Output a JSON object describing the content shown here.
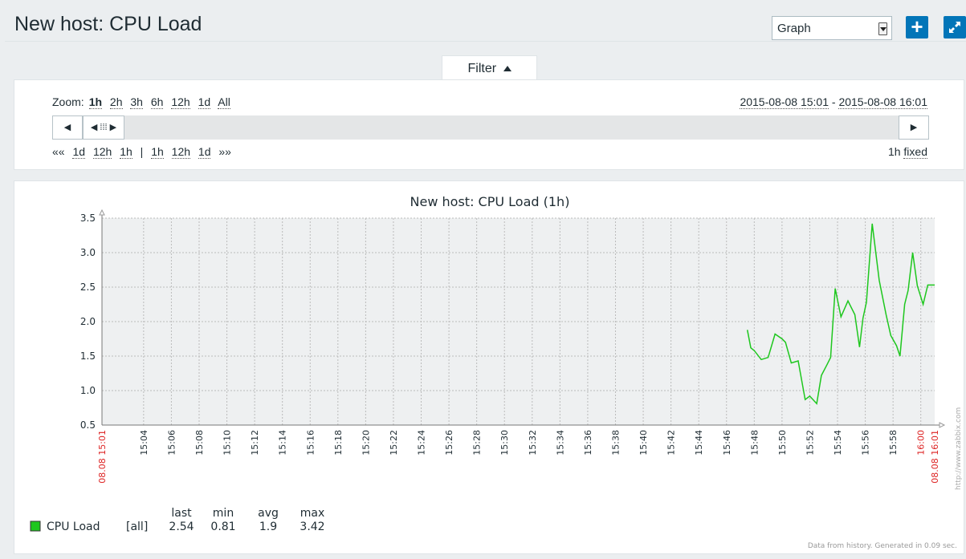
{
  "header": {
    "title": "New host: CPU Load",
    "view_select": "Graph"
  },
  "filter": {
    "tab_label": "Filter",
    "zoom_label": "Zoom:",
    "zoom_options": [
      "1h",
      "2h",
      "3h",
      "6h",
      "12h",
      "1d",
      "All"
    ],
    "period_from": "2015-08-08 15:01",
    "period_separator": "-",
    "period_to": "2015-08-08 16:01",
    "nav_back_label": "««",
    "nav_back": [
      "1d",
      "12h",
      "1h"
    ],
    "nav_separator": "|",
    "nav_forward": [
      "1h",
      "12h",
      "1d"
    ],
    "nav_forward_label": "»»",
    "period_length": "1h",
    "period_mode": "fixed"
  },
  "graph": {
    "title": "New host: CPU Load (1h)",
    "watermark": "http://www.zabbix.com",
    "footer_note": "Data from history. Generated in 0.09 sec.",
    "line_color": "#1ec71e",
    "grid_color": "#bbbbbb",
    "plot_bg": "#eef0f1",
    "label_red": "#dd2222",
    "legend_headers": [
      "last",
      "min",
      "avg",
      "max"
    ],
    "legend": [
      {
        "name": "CPU Load",
        "func": "[all]",
        "last": "2.54",
        "min": "0.81",
        "avg": "1.9",
        "max": "3.42",
        "color": "#1ec71e"
      }
    ]
  },
  "chart_data": {
    "type": "line",
    "title": "New host: CPU Load (1h)",
    "xlabel": "",
    "ylabel": "",
    "ylim": [
      0.5,
      3.5
    ],
    "y_ticks": [
      "0.5",
      "1.0",
      "1.5",
      "2.0",
      "2.5",
      "3.0",
      "3.5"
    ],
    "x_range_minutes": [
      0,
      60
    ],
    "x_tick_labels": [
      "15:04",
      "15:06",
      "15:08",
      "15:10",
      "15:12",
      "15:14",
      "15:16",
      "15:18",
      "15:20",
      "15:22",
      "15:24",
      "15:26",
      "15:28",
      "15:30",
      "15:32",
      "15:34",
      "15:36",
      "15:38",
      "15:40",
      "15:42",
      "15:44",
      "15:46",
      "15:48",
      "15:50",
      "15:52",
      "15:54",
      "15:56",
      "15:58",
      "16:00"
    ],
    "x_edge_labels": [
      "08.08 15:01",
      "08.08 16:01"
    ],
    "red_x_tick": "16:00",
    "grid": true,
    "series": [
      {
        "name": "CPU Load",
        "points": [
          [
            "15:47:30",
            1.88
          ],
          [
            "15:47:45",
            1.62
          ],
          [
            "15:48:00",
            1.58
          ],
          [
            "15:48:30",
            1.45
          ],
          [
            "15:49:00",
            1.48
          ],
          [
            "15:49:30",
            1.82
          ],
          [
            "15:50:00",
            1.75
          ],
          [
            "15:50:15",
            1.7
          ],
          [
            "15:50:40",
            1.4
          ],
          [
            "15:51:10",
            1.43
          ],
          [
            "15:51:40",
            0.87
          ],
          [
            "15:52:00",
            0.92
          ],
          [
            "15:52:30",
            0.81
          ],
          [
            "15:52:50",
            1.22
          ],
          [
            "15:53:15",
            1.38
          ],
          [
            "15:53:30",
            1.48
          ],
          [
            "15:53:50",
            2.48
          ],
          [
            "15:54:15",
            2.07
          ],
          [
            "15:54:45",
            2.3
          ],
          [
            "15:55:15",
            2.1
          ],
          [
            "15:55:35",
            1.63
          ],
          [
            "15:55:50",
            2.05
          ],
          [
            "15:56:05",
            2.28
          ],
          [
            "15:56:30",
            3.42
          ],
          [
            "15:57:00",
            2.6
          ],
          [
            "15:57:30",
            2.1
          ],
          [
            "15:57:50",
            1.8
          ],
          [
            "15:58:15",
            1.65
          ],
          [
            "15:58:30",
            1.5
          ],
          [
            "15:58:50",
            2.25
          ],
          [
            "15:59:05",
            2.45
          ],
          [
            "15:59:25",
            3.0
          ],
          [
            "15:59:45",
            2.52
          ],
          [
            "16:00:10",
            2.25
          ],
          [
            "16:00:30",
            2.53
          ],
          [
            "16:01:00",
            2.53
          ]
        ]
      }
    ]
  }
}
